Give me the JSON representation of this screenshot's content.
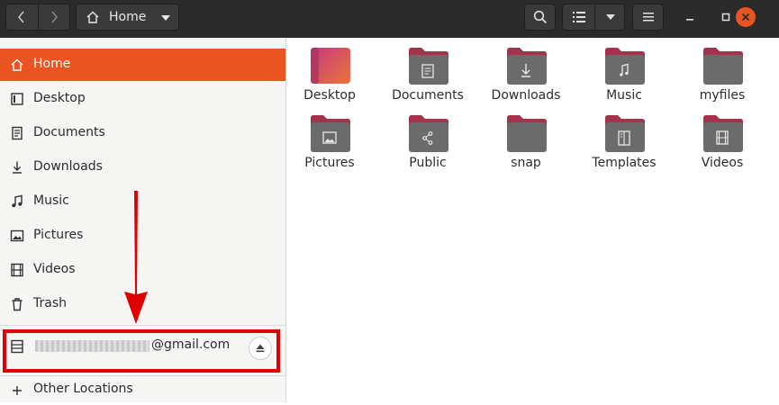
{
  "header": {
    "path_label": "Home",
    "icons": [
      "chevron-left-icon",
      "chevron-right-icon",
      "home-icon",
      "caret-down-icon",
      "search-icon",
      "list-view-icon",
      "hamburger-menu-icon",
      "minimize-icon",
      "maximize-icon",
      "close-icon"
    ]
  },
  "sidebar": {
    "items": [
      {
        "label": "Home",
        "icon": "home-icon",
        "active": true
      },
      {
        "label": "Desktop",
        "icon": "desktop-icon"
      },
      {
        "label": "Documents",
        "icon": "document-icon"
      },
      {
        "label": "Downloads",
        "icon": "download-icon"
      },
      {
        "label": "Music",
        "icon": "music-note-icon"
      },
      {
        "label": "Pictures",
        "icon": "picture-icon"
      },
      {
        "label": "Videos",
        "icon": "film-icon"
      },
      {
        "label": "Trash",
        "icon": "trash-icon"
      }
    ],
    "account": {
      "email_suffix": "@gmail.com",
      "icon": "server-drive-icon"
    },
    "other": {
      "label": "Other Locations",
      "icon": "plus-icon"
    }
  },
  "folders": [
    {
      "label": "Desktop",
      "emblem": "desktop"
    },
    {
      "label": "Documents",
      "emblem": "document"
    },
    {
      "label": "Downloads",
      "emblem": "download"
    },
    {
      "label": "Music",
      "emblem": "music"
    },
    {
      "label": "myfiles",
      "emblem": "none"
    },
    {
      "label": "Pictures",
      "emblem": "picture"
    },
    {
      "label": "Public",
      "emblem": "share"
    },
    {
      "label": "snap",
      "emblem": "none"
    },
    {
      "label": "Templates",
      "emblem": "template"
    },
    {
      "label": "Videos",
      "emblem": "film"
    }
  ],
  "colors": {
    "accent": "#e95420",
    "header_bg": "#2b2b2b",
    "folder_body": "#6b6b6b",
    "folder_tab": "#a3324a",
    "annotation": "#e00000"
  }
}
